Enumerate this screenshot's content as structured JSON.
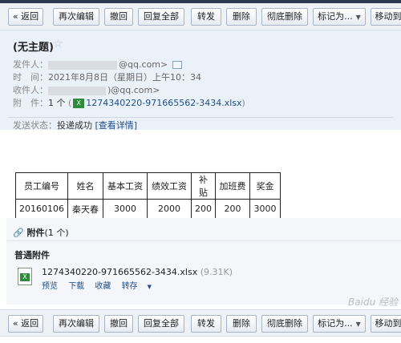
{
  "toolbar": {
    "back": "« 返回",
    "edit_again": "再次编辑",
    "recall": "撤回",
    "reply_all": "回复全部",
    "forward": "转发",
    "delete": "删除",
    "delete_permanently": "彻底删除",
    "mark_as": "标记为...",
    "move_to": "移动到"
  },
  "mail": {
    "subject": "(无主题)",
    "star": "☆",
    "from_label": "发件人：",
    "from_value": "@qq.com>",
    "time_label": "时　间：",
    "time_value": "2021年8月8日（星期日）上午10：34",
    "to_label": "收件人：",
    "to_value": ")@qq.com>",
    "attach_label": "附　件：",
    "attach_count": "1 个",
    "attach_file": "1274340220-971665562-3434.xlsx",
    "status_label": "发送状态：",
    "status_value": "投递成功",
    "status_link": "[查看详情]"
  },
  "table": {
    "headers": [
      "员工编号",
      "姓名",
      "基本工资",
      "绩效工资",
      "补贴",
      "加班费",
      "奖金"
    ],
    "rows": [
      [
        "20160106",
        "秦天春",
        "3000",
        "2000",
        "200",
        "200",
        "3000"
      ]
    ]
  },
  "attachments": {
    "title": "附件",
    "count": "(1 个)",
    "section": "普通附件",
    "file_name": "1274340220-971665562-3434.xlsx",
    "file_size": "(9.31K)",
    "preview": "预览",
    "download": "下载",
    "favorite": "收藏",
    "save_to": "转存"
  },
  "watermark": "Baidu 经验"
}
